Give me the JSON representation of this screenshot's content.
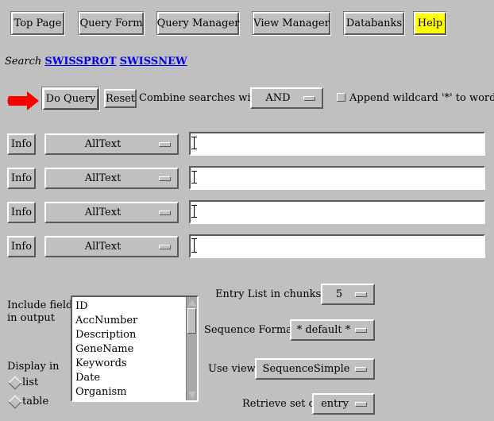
{
  "nav": {
    "top_page": "Top Page",
    "query_form": "Query Form",
    "query_manager": "Query Manager",
    "view_manager": "View Manager",
    "databanks": "Databanks",
    "help": "Help"
  },
  "search": {
    "prefix": "Search",
    "databanks": [
      "SWISSPROT",
      "SWISSNEW"
    ]
  },
  "query_bar": {
    "do_query": "Do Query",
    "reset": "Reset",
    "combine_label": "Combine searches with",
    "combine_value": "AND",
    "wildcard_label": "Append wildcard '*' to words.",
    "wildcard_checked": false
  },
  "query_rows": [
    {
      "info": "Info",
      "field": "AllText",
      "value": ""
    },
    {
      "info": "Info",
      "field": "AllText",
      "value": ""
    },
    {
      "info": "Info",
      "field": "AllText",
      "value": ""
    },
    {
      "info": "Info",
      "field": "AllText",
      "value": ""
    }
  ],
  "output": {
    "include_fields_label_1": "Include fields",
    "include_fields_label_2": "in output",
    "fields": [
      "ID",
      "AccNumber",
      "Description",
      "GeneName",
      "Keywords",
      "Date",
      "Organism"
    ],
    "display_in_label": "Display in",
    "display_options": [
      "list",
      "table"
    ]
  },
  "settings": {
    "chunks_label": "Entry List in chunks of",
    "chunks_value": "5",
    "seq_format_label": "Sequence Format",
    "seq_format_value": "* default *",
    "use_view_label": "Use view",
    "use_view_value": "SequenceSimple",
    "retrieve_label": "Retrieve set of",
    "retrieve_value": "entry"
  },
  "colors": {
    "background": "#c0c0c0",
    "help_bg": "#ffff00",
    "link": "#0000ee",
    "arrow": "#ff0000"
  }
}
